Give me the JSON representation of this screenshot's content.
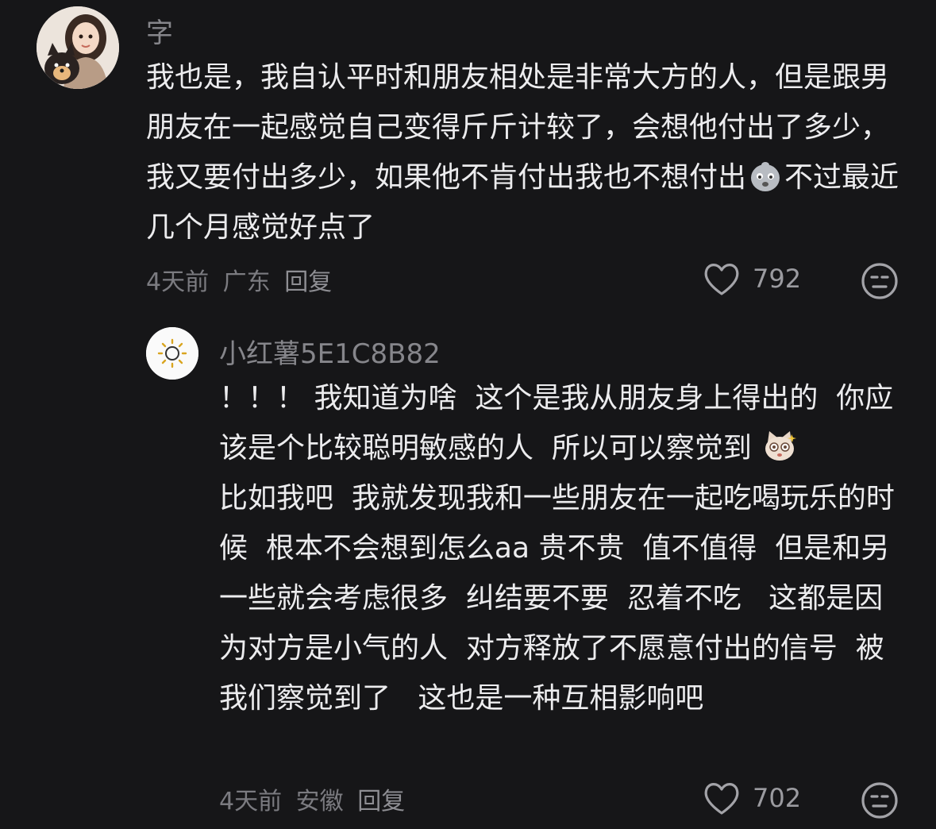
{
  "comments": [
    {
      "username": "字",
      "text_part1": "我也是，我自认平时和朋友相处是非常大方的人，但是跟男朋友在一起感觉自己变得斤斤计较了，会想他付出了多少，我又要付出多少，如果他不肯付出我也不想付出",
      "emoji": "sad-face-emoji",
      "text_part2": "不过最近几个月感觉好点了",
      "time": "4天前",
      "location": "广东",
      "reply_label": "回复",
      "likes": "792"
    },
    {
      "username": "小红薯5E1C8B82",
      "text_part1": "！！！ 我知道为啥  这个是我从朋友身上得出的  你应该是个比较聪明敏感的人  所以可以察觉到 ",
      "emoji": "cat-face-emoji",
      "text_part2": "\n比如我吧  我就发现我和一些朋友在一起吃喝玩乐的时候  根本不会想到怎么aa 贵不贵  值不值得  但是和另一些就会考虑很多  纠结要不要  忍着不吃   这都是因为对方是小气的人  对方释放了不愿意付出的信号  被我们察觉到了   这也是一种互相影响吧",
      "time": "4天前",
      "location": "安徽",
      "reply_label": "回复",
      "likes": "702"
    }
  ],
  "colors": {
    "background": "#161618",
    "text": "#ececee",
    "meta": "#7b7b80"
  }
}
